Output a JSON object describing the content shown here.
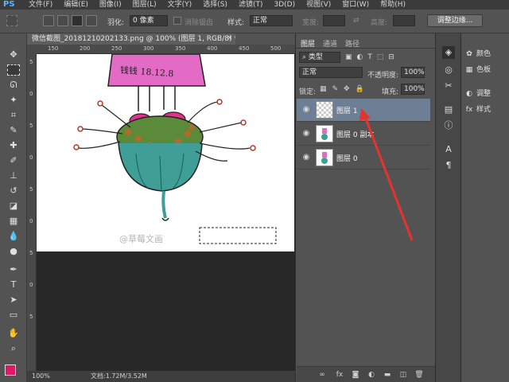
{
  "menubar": {
    "logo": "PS",
    "items": [
      "文件(F)",
      "编辑(E)",
      "图像(I)",
      "图层(L)",
      "文字(Y)",
      "选择(S)",
      "滤镜(T)",
      "3D(D)",
      "视图(V)",
      "窗口(W)",
      "帮助(H)"
    ]
  },
  "options": {
    "feather_label": "羽化:",
    "feather_value": "0 像素",
    "antialias_label": "消除锯齿",
    "style_label": "样式:",
    "style_value": "正常",
    "width_label": "宽度:",
    "height_label": "高度:",
    "refine_edge": "调整边缘..."
  },
  "document": {
    "tab_title": "微信截图_20181210202133.png @ 100% (图层 1, RGB/8) *",
    "ruler_top": [
      "150",
      "200",
      "250",
      "300",
      "350",
      "400",
      "450",
      "500"
    ],
    "ruler_left": [
      "5",
      "0",
      "5",
      "0",
      "5",
      "0",
      "5",
      "0",
      "5"
    ],
    "canvas_text": "钱钱 18.12.8",
    "watermark": "@草莓文画",
    "status_zoom": "100%",
    "status_doc": "文档:1.72M/3.52M"
  },
  "layers_panel": {
    "tabs": [
      "图层",
      "通道",
      "路径"
    ],
    "filter_kind": "类型",
    "blend_mode": "正常",
    "opacity_label": "不透明度:",
    "opacity_value": "100%",
    "lock_label": "锁定:",
    "fill_label": "填充:",
    "fill_value": "100%",
    "layers": [
      {
        "name": "图层 1",
        "selected": true
      },
      {
        "name": "图层 0 副本",
        "selected": false
      },
      {
        "name": "图层 0",
        "selected": false
      }
    ]
  },
  "right_panel": {
    "items": [
      "颜色",
      "色板",
      "调整",
      "样式"
    ]
  },
  "colors": {
    "selected_layer": "#6c7f95",
    "foreground": "#e0186a",
    "arrow": "#e8322b"
  }
}
